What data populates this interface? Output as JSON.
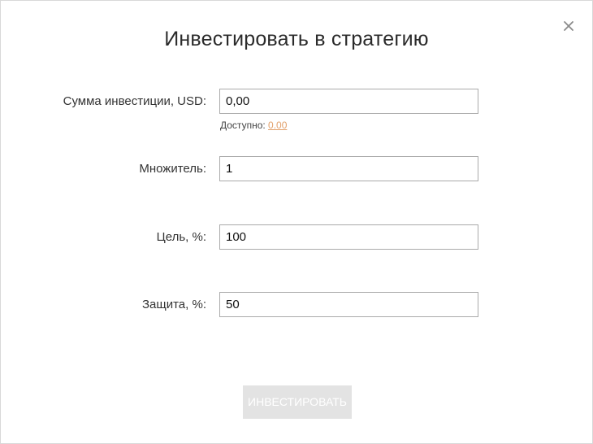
{
  "dialog": {
    "title": "Инвестировать в стратегию",
    "close_icon": "close-icon"
  },
  "form": {
    "amount": {
      "label": "Сумма инвестиции, USD:",
      "value": "0,00"
    },
    "available": {
      "label": "Доступно:",
      "value": "0.00"
    },
    "multiplier": {
      "label": "Множитель:",
      "value": "1"
    },
    "target": {
      "label": "Цель, %:",
      "value": "100"
    },
    "protection": {
      "label": "Защита, %:",
      "value": "50"
    }
  },
  "actions": {
    "invest_label": "ИНВЕСТИРОВАТЬ",
    "invest_disabled": true
  },
  "colors": {
    "link": "#e2a06a",
    "button_disabled_bg": "#e3e3e3",
    "input_border": "#aaaaaa"
  }
}
